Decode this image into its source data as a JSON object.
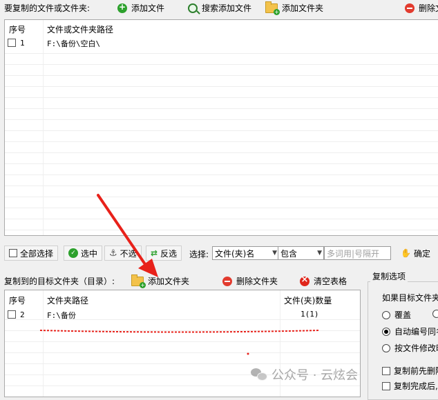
{
  "top_toolbar": {
    "title": "要复制的文件或文件夹:",
    "add_file": "添加文件",
    "search_add_file": "搜索添加文件",
    "add_folder": "添加文件夹",
    "delete_file": "删除文"
  },
  "source_table": {
    "col_index": "序号",
    "col_path": "文件或文件夹路径",
    "rows": [
      {
        "index": "1",
        "path": "F:\\备份\\空白\\"
      }
    ]
  },
  "select_bar": {
    "select_all": "全部选择",
    "select_checked": "选中",
    "deselect": "不选",
    "invert": "反选",
    "choose_label": "选择:",
    "field_select": "文件(夹)名",
    "match_select": "包含",
    "keyword_placeholder": "多词用|号隔开",
    "confirm": "确定"
  },
  "target_toolbar": {
    "title": "复制到的目标文件夹（目录）:",
    "add_folder": "添加文件夹",
    "delete_folder": "删除文件夹",
    "clear_table": "清空表格"
  },
  "target_table": {
    "col_index": "序号",
    "col_path": "文件夹路径",
    "col_count": "文件(夹)数量",
    "rows": [
      {
        "index": "2",
        "path": "F:\\备份",
        "count": "1(1)"
      }
    ]
  },
  "copy_options": {
    "title": "复制选项",
    "if_target_exists": "如果目标文件夹",
    "overwrite": "覆盖",
    "auto_rename": "自动编号同名",
    "by_modified": "按文件修改时",
    "delete_before_copy": "复制前先删除",
    "after_copy": "复制完成后,"
  },
  "watermark": "公众号 · 云炫会",
  "colors": {
    "annotation_red": "#e8211a",
    "toolbar_green": "#2da12d",
    "toolbar_red": "#e23b2e"
  }
}
